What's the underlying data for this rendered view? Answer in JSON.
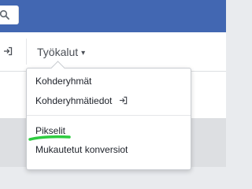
{
  "app": {
    "accent_color": "#4267b2"
  },
  "toolbar": {
    "tools_label": "Työkalut",
    "tools_caret": "▾"
  },
  "menu": {
    "items": [
      {
        "label": "Kohderyhmät",
        "icon": null
      },
      {
        "label": "Kohderyhmätiedot",
        "icon": "exit-icon"
      },
      {
        "label": "Pikselit",
        "icon": null,
        "annotated": true
      },
      {
        "label": "Mukautetut konversiot",
        "icon": null
      }
    ]
  },
  "annotation": {
    "color": "#2ecc40"
  }
}
